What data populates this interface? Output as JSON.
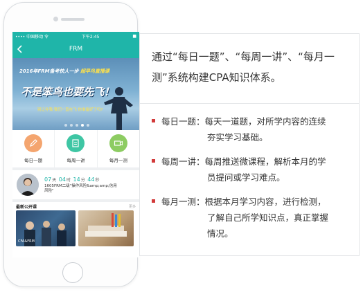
{
  "phone": {
    "status": {
      "carrier": "•••• 中国移动 令",
      "time": "下午2:45",
      "battery": "■"
    },
    "nav": {
      "title": "FRM"
    },
    "banner": {
      "headline_prefix": "2016年FRM备考快人一步 ",
      "headline_highlight": "超早鸟直播课",
      "big_slogan": "不是笨鸟也要先飞！",
      "sub": "别让孙我·我们一直在飞 你准备好了吗?"
    },
    "features": [
      {
        "label": "每日一题",
        "color": "#f4a56f",
        "icon": "pencil-icon"
      },
      {
        "label": "每周一讲",
        "color": "#3fc6a4",
        "icon": "document-icon"
      },
      {
        "label": "每月一测",
        "color": "#8dcc62",
        "icon": "video-icon"
      }
    ],
    "live": {
      "days": "07",
      "days_unit": "天",
      "hours": "04",
      "hours_unit": "时",
      "minutes": "14",
      "minutes_unit": "分",
      "seconds": "44",
      "seconds_unit": "秒",
      "title": "1605FRM二级\"操作风险&amp;amp;信用风险\""
    },
    "courses": {
      "heading": "最新公开课",
      "more": "更多",
      "items": [
        {
          "caption": "CFA&FRM"
        },
        {
          "caption": ""
        }
      ]
    }
  },
  "card": {
    "heading": "通过“每日一题”、“每周一讲”、“每月一测”系统构建CPA知识体系。",
    "items": [
      {
        "label": "每日一题：",
        "line1": "每天一道题，对所学内容的连续",
        "line2": "夯实学习基础。",
        "line3": ""
      },
      {
        "label": "每周一讲：",
        "line1": "每周推送微课程，解析本月的学",
        "line2": "员提问或学习难点。",
        "line3": ""
      },
      {
        "label": "每月一测：",
        "line1": "根据本月学习内容，进行检测，",
        "line2": "了解自己所学知识点，真正掌握",
        "line3": "情况。"
      }
    ]
  }
}
